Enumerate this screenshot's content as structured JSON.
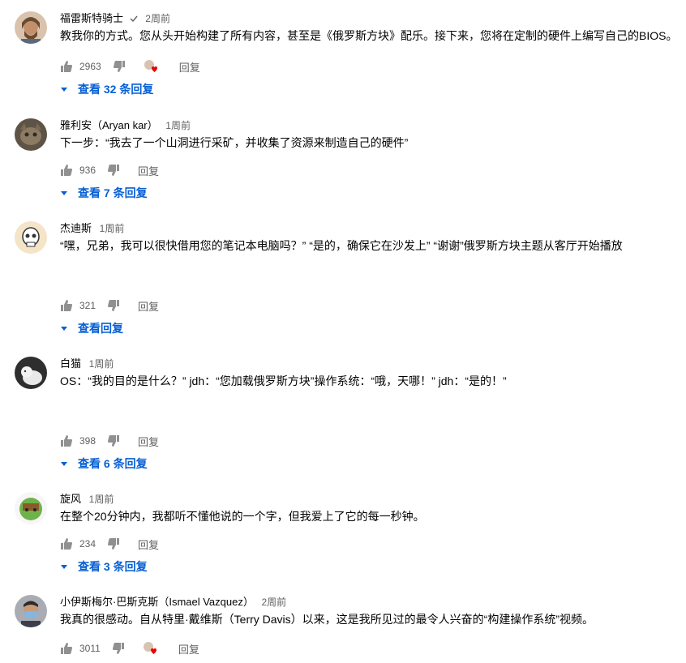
{
  "comments": [
    {
      "author": "福雷斯特骑士",
      "verified": true,
      "time": "2周前",
      "text": "教我你的方式。您从头开始构建了所有内容，甚至是《俄罗斯方块》配乐。接下来，您将在定制的硬件上编写自己的BIOS。",
      "likes": "2963",
      "reply_label": "回复",
      "creator_heart": true,
      "view_replies": "查看 32 条回复",
      "avatar_color": "#b89a80"
    },
    {
      "author": "雅利安（Aryan kar）",
      "time": "1周前",
      "text": "下一步：“我去了一个山洞进行采矿，并收集了资源来制造自己的硬件”",
      "likes": "936",
      "reply_label": "回复",
      "view_replies": "查看 7 条回复",
      "avatar_color": "#7a6a56"
    },
    {
      "author": "杰迪斯",
      "time": "1周前",
      "text": "“嘿，兄弟，我可以很快借用您的笔记本电脑吗？” “是的，确保它在沙发上” “谢谢”俄罗斯方块主题从客厅开始播放",
      "likes": "321",
      "reply_label": "回复",
      "view_replies": "查看回复",
      "avatar_color": "#f4e4c8"
    },
    {
      "author": "白猫",
      "time": "1周前",
      "text": "OS：“我的目的是什么？” jdh：“您加载俄罗斯方块”操作系统：“哦，天哪！” jdh：“是的！”",
      "likes": "398",
      "reply_label": "回复",
      "view_replies": "查看 6 条回复",
      "avatar_color": "#3a3a3a"
    },
    {
      "author": "旋风",
      "time": "1周前",
      "text": "在整个20分钟内，我都听不懂他说的一个字，但我爱上了它的每一秒钟。",
      "likes": "234",
      "reply_label": "回复",
      "view_replies": "查看 3 条回复",
      "avatar_color": "#6fb24a"
    },
    {
      "author": "小伊斯梅尔·巴斯克斯（Ismael Vazquez）",
      "time": "2周前",
      "text": "我真的很感动。自从特里·戴维斯（Terry Davis）以来，这是我所见过的最令人兴奋的“构建操作系统”视频。",
      "likes": "3011",
      "reply_label": "回复",
      "creator_heart": true,
      "avatar_color": "#8a8f98"
    }
  ]
}
